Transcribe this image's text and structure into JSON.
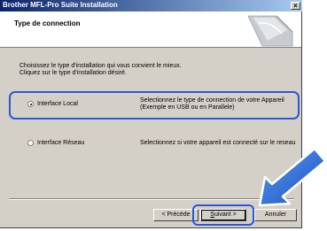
{
  "window": {
    "title": "Brother MFL-Pro Suite Installation",
    "close_glyph": "×"
  },
  "header": {
    "title": "Type de connection"
  },
  "instructions": {
    "line1": "Choisissez le type d'installation qui vous convient le mieux.",
    "line2": "Cliquez sur le type d'installation désiré."
  },
  "options": [
    {
      "label": "Interface Local",
      "selected": true,
      "desc_line1": "Selectionnez le type de connection de votre Appareil",
      "desc_line2": "(Exemple en USB ou en Parallele)"
    },
    {
      "label": "Interface Réseau",
      "selected": false,
      "desc_line1": "Selectionnez si votre appareil est connecté sur le reseau",
      "desc_line2": ""
    }
  ],
  "buttons": {
    "back": "< Précéde",
    "next_prefix": "",
    "next_mnemonic": "S",
    "next_rest": "uivant >",
    "cancel": "Annuler"
  },
  "colors": {
    "title_gradient_start": "#0a246a",
    "highlight": "#2b56d6",
    "arrow": "#2a6fd8"
  },
  "icons": {
    "header_graphic": "cd-disc-graphic",
    "pointer": "pointer-arrow-icon"
  }
}
